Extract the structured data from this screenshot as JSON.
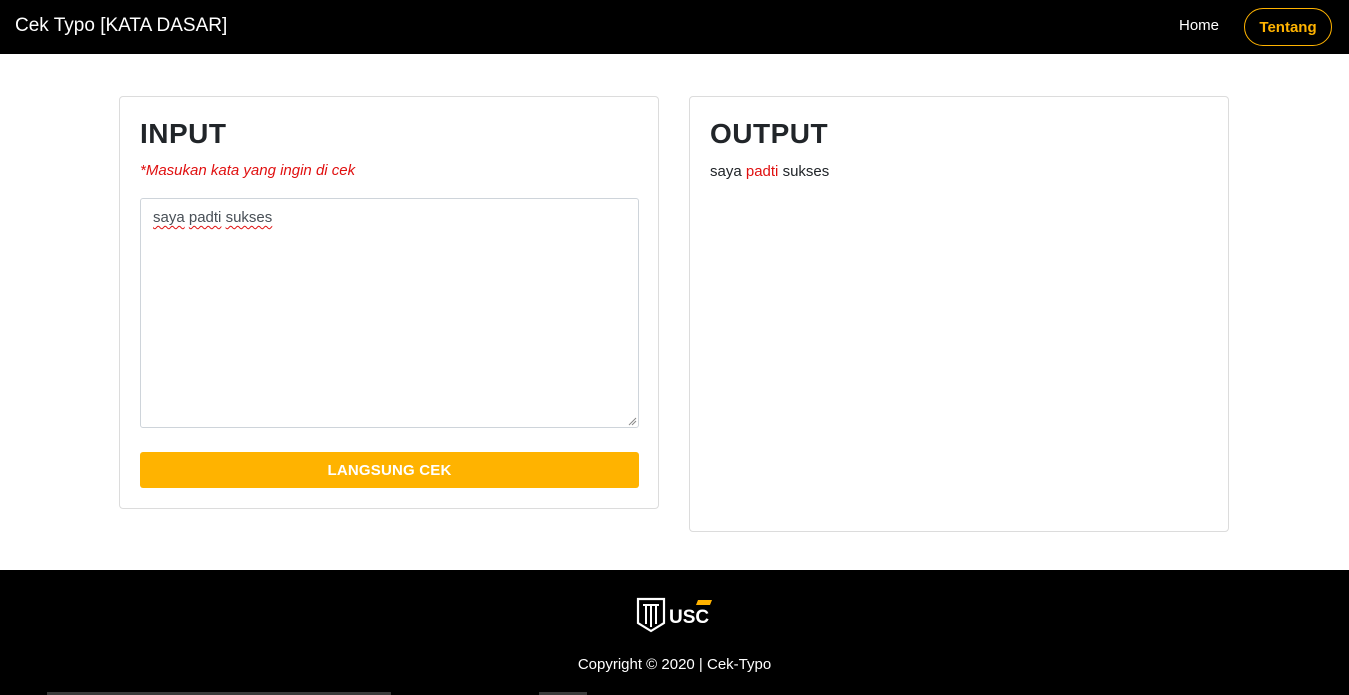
{
  "navbar": {
    "brand": "Cek Typo [KATA DASAR]",
    "home_label": "Home",
    "about_label": "Tentang"
  },
  "input_card": {
    "title": "INPUT",
    "hint": "*Masukan kata yang ingin di cek",
    "textarea_words": [
      "saya",
      "padti",
      "sukses"
    ],
    "button_label": "LANGSUNG CEK"
  },
  "output_card": {
    "title": "OUTPUT",
    "words": [
      {
        "text": "saya",
        "typo": false
      },
      {
        "text": "padti",
        "typo": true
      },
      {
        "text": "sukses",
        "typo": false
      }
    ]
  },
  "footer": {
    "logo_text": "USC",
    "copyright": "Copyright © 2020 | Cek-Typo"
  },
  "colors": {
    "navbar_bg": "#000000",
    "accent": "#ffb300",
    "typo_red": "#e01010"
  }
}
